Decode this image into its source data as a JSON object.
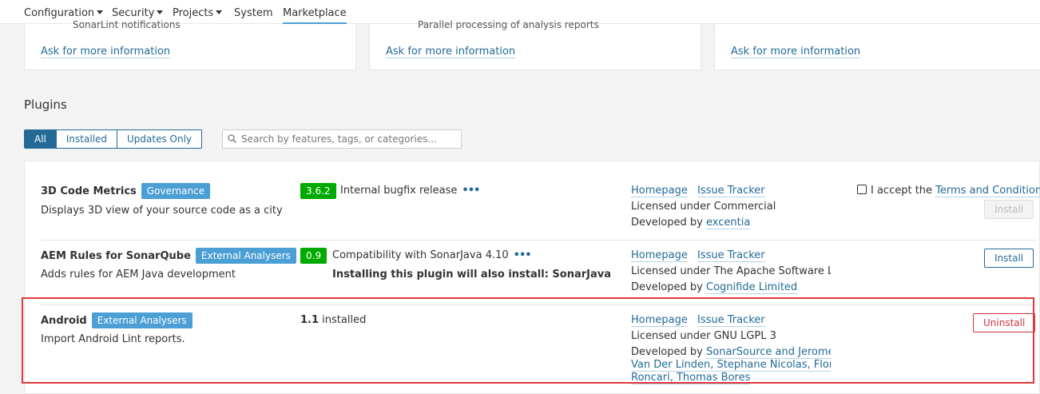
{
  "nav": {
    "items": [
      {
        "label": "Configuration",
        "has_caret": true
      },
      {
        "label": "Security",
        "has_caret": true
      },
      {
        "label": "Projects",
        "has_caret": true
      },
      {
        "label": "System",
        "has_caret": false
      },
      {
        "label": "Marketplace",
        "has_caret": false,
        "active": true
      }
    ]
  },
  "feature_cards": [
    {
      "cut_text": "SonarLint notifications",
      "link": "Ask for more information"
    },
    {
      "cut_text": "Parallel processing of analysis reports",
      "link": "Ask for more information"
    },
    {
      "cut_text": "",
      "link": "Ask for more information"
    }
  ],
  "plugins_section": {
    "title": "Plugins",
    "tabs": [
      "All",
      "Installed",
      "Updates Only"
    ],
    "selected_tab": "All",
    "search_placeholder": "Search by features, tags, or categories..."
  },
  "plugins": [
    {
      "name": "3D Code Metrics",
      "category": "Governance",
      "description": "Displays 3D view of your source code as a city",
      "version": "3.6.2",
      "release_note": "Internal bugfix release",
      "homepage": "Homepage",
      "issue_tracker": "Issue Tracker",
      "license": "Licensed under Commercial",
      "developed_by_prefix": "Developed by",
      "developer": "excentia",
      "terms_prefix": "I accept the",
      "terms_link": "Terms and Conditions",
      "action": "Install"
    },
    {
      "name": "AEM Rules for SonarQube",
      "category": "External Analysers",
      "description": "Adds rules for AEM Java development",
      "version": "0.9",
      "release_note": "Compatibility with SonarJava 4.10",
      "install_note": "Installing this plugin will also install: SonarJava",
      "homepage": "Homepage",
      "issue_tracker": "Issue Tracker",
      "license": "Licensed under The Apache Software Lic...",
      "developed_by_prefix": "Developed by",
      "developer": "Cognifide Limited",
      "action": "Install"
    },
    {
      "name": "Android",
      "category": "External Analysers",
      "description": "Import Android Lint reports.",
      "installed_version": "1.1",
      "installed_label": "installed",
      "homepage": "Homepage",
      "issue_tracker": "Issue Tracker",
      "license": "Licensed under GNU LGPL 3",
      "developed_by_prefix": "Developed by",
      "developer_line1": "SonarSource and Jerome",
      "developer_line2": "Van Der Linden, Stephane Nicolas, Florian",
      "developer_line3": "Roncari, Thomas Bores",
      "action": "Uninstall"
    }
  ],
  "colors": {
    "link": "#236a97",
    "badge": "#4b9fd5",
    "version_badge": "#00aa00",
    "uninstall": "#d4333f",
    "highlight": "#e0393e"
  }
}
